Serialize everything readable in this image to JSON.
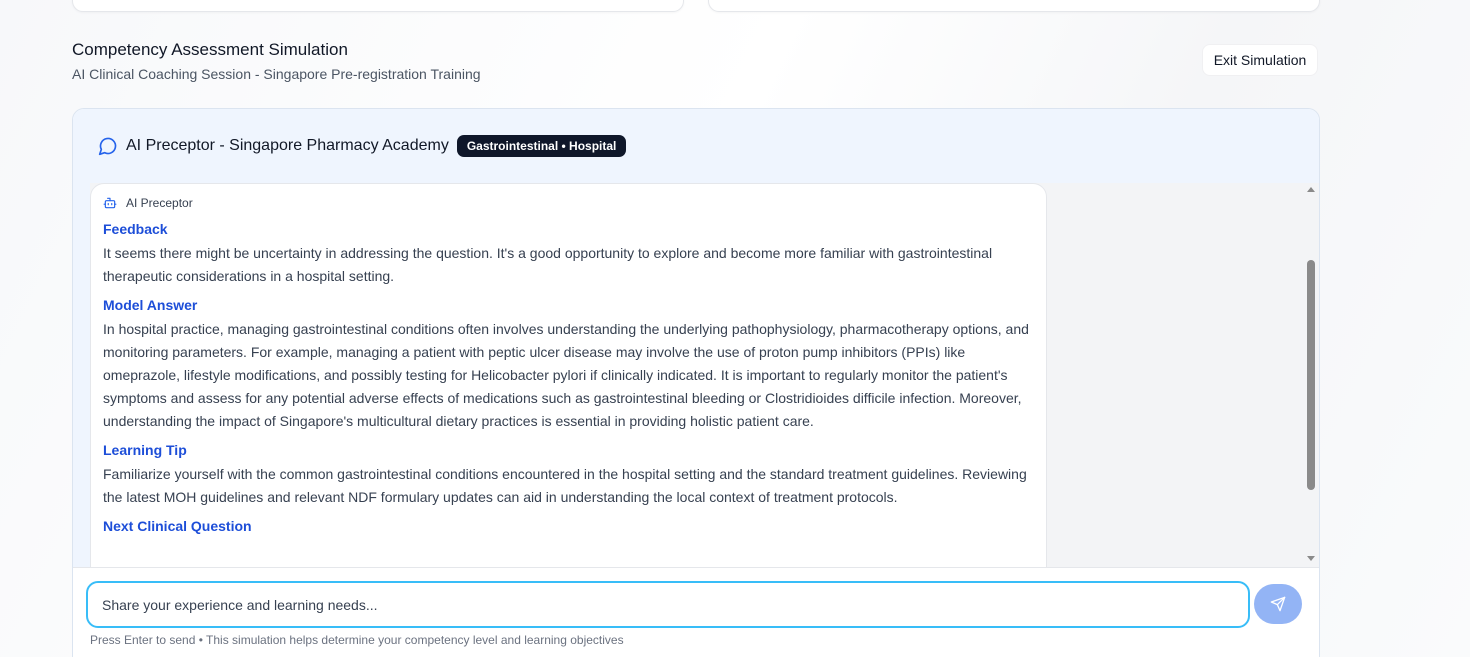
{
  "header": {
    "title": "Competency Assessment Simulation",
    "subtitle": "AI Clinical Coaching Session - Singapore Pre-registration Training",
    "exit_label": "Exit Simulation"
  },
  "chat": {
    "title": "AI Preceptor - Singapore Pharmacy Academy",
    "tag": "Gastrointestinal • Hospital",
    "message": {
      "sender": "AI Preceptor",
      "sections": [
        {
          "title": "Feedback",
          "body": "It seems there might be uncertainty in addressing the question. It's a good opportunity to explore and become more familiar with gastrointestinal therapeutic considerations in a hospital setting."
        },
        {
          "title": "Model Answer",
          "body": "In hospital practice, managing gastrointestinal conditions often involves understanding the underlying pathophysiology, pharmacotherapy options, and monitoring parameters. For example, managing a patient with peptic ulcer disease may involve the use of proton pump inhibitors (PPIs) like omeprazole, lifestyle modifications, and possibly testing for Helicobacter pylori if clinically indicated. It is important to regularly monitor the patient's symptoms and assess for any potential adverse effects of medications such as gastrointestinal bleeding or Clostridioides difficile infection. Moreover, understanding the impact of Singapore's multicultural dietary practices is essential in providing holistic patient care."
        },
        {
          "title": "Learning Tip",
          "body": "Familiarize yourself with the common gastrointestinal conditions encountered in the hospital setting and the standard treatment guidelines. Reviewing the latest MOH guidelines and relevant NDF formulary updates can aid in understanding the local context of treatment protocols."
        },
        {
          "title": "Next Clinical Question",
          "body": ""
        }
      ]
    }
  },
  "composer": {
    "placeholder": "Share your experience and learning needs...",
    "hint": "Press Enter to send • This simulation helps determine your competency level and learning objectives"
  },
  "colors": {
    "accent": "#1d4ed8",
    "input_border": "#38bdf8",
    "send_button": "#93b4f5",
    "header_bg": "#eff5fe",
    "tag_bg": "#0f172a"
  },
  "icons": {
    "chat": "chat-bubble-icon",
    "bot": "bot-icon",
    "send": "send-icon"
  }
}
